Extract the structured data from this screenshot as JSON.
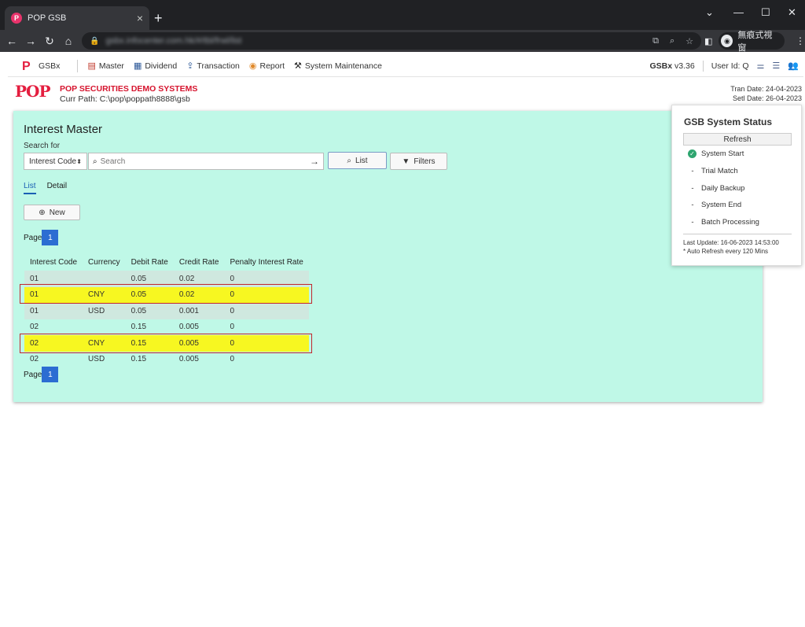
{
  "browser": {
    "tab_title": "POP GSB",
    "tab_close": "×",
    "new_tab": "+",
    "url": "gsbx.infocenter.com.hk/#/tbl/frwl/list",
    "profile_label": "無痕式視窗"
  },
  "appnav": {
    "brand": "GSBx",
    "items": [
      {
        "label": "Master",
        "icon": "master-icon"
      },
      {
        "label": "Dividend",
        "icon": "dividend-icon"
      },
      {
        "label": "Transaction",
        "icon": "transaction-icon"
      },
      {
        "label": "Report",
        "icon": "report-icon"
      },
      {
        "label": "System Maintenance",
        "icon": "hammer-icon"
      }
    ],
    "app_name": "GSBx",
    "version": "v3.36",
    "user": "User Id: Q"
  },
  "header": {
    "company": "POP SECURITIES DEMO SYSTEMS",
    "curr_path": "Curr Path: C:\\pop\\poppath8888\\gsb",
    "tran_date": "Tran Date: 24-04-2023",
    "setl_date": "Setl Date: 26-04-2023",
    "logo_text": "POP"
  },
  "panel": {
    "title": "Interest Master",
    "search_label": "Search for",
    "select_value": "Interest Code",
    "search_placeholder": "Search",
    "list_button": "List",
    "filters_button": "Filters",
    "tabs": [
      "List",
      "Detail"
    ],
    "new_button": "New",
    "page_label": "Page",
    "page_number": "1"
  },
  "table": {
    "columns": [
      "Interest Code",
      "Currency",
      "Debit Rate",
      "Credit Rate",
      "Penalty Interest Rate"
    ],
    "rows": [
      [
        "01",
        "",
        "0.05",
        "0.02",
        "0"
      ],
      [
        "01",
        "CNY",
        "0.05",
        "0.02",
        "0"
      ],
      [
        "01",
        "USD",
        "0.05",
        "0.001",
        "0"
      ],
      [
        "02",
        "",
        "0.15",
        "0.005",
        "0"
      ],
      [
        "02",
        "CNY",
        "0.15",
        "0.005",
        "0"
      ],
      [
        "02",
        "USD",
        "0.15",
        "0.005",
        "0"
      ]
    ]
  },
  "status": {
    "title": "GSB System Status",
    "refresh": "Refresh",
    "items": [
      {
        "label": "System Start",
        "done": true
      },
      {
        "label": "Trial Match",
        "done": false
      },
      {
        "label": "Daily Backup",
        "done": false
      },
      {
        "label": "System End",
        "done": false
      },
      {
        "label": "Batch Processing",
        "done": false
      }
    ],
    "last_update": "Last Update: 16-06-2023 14:53:00",
    "auto_refresh": "* Auto Refresh every 120 Mins"
  },
  "colors": {
    "panel_bg": "#bff8e7",
    "highlight": "#f7f721",
    "highlight_border": "#c1272d",
    "accent": "#2c6dd2",
    "brand_red": "#e41e3f"
  }
}
